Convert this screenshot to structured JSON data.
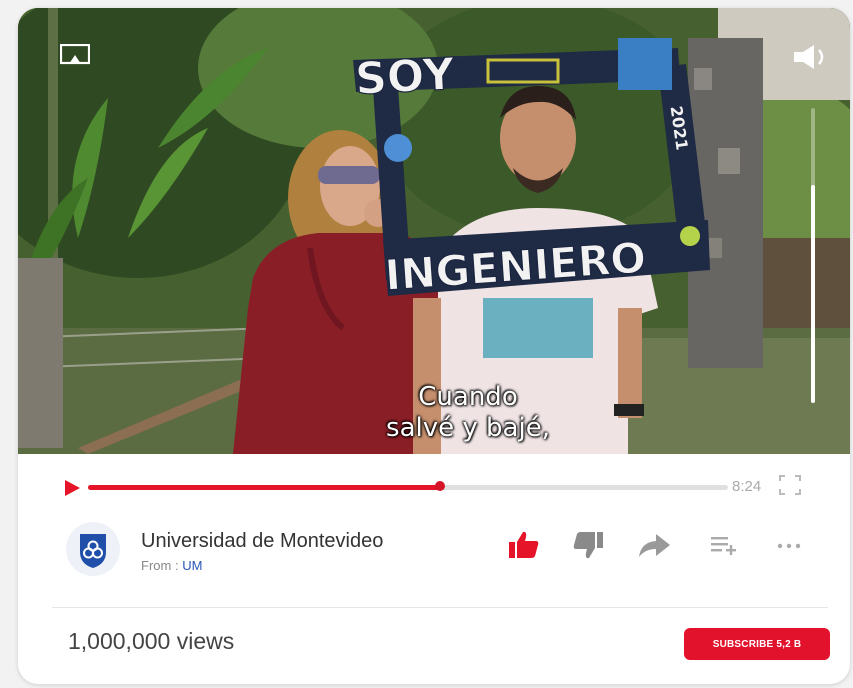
{
  "video": {
    "caption_line1": "Cuando",
    "caption_line2": "salvé y bajé,",
    "frame_sign_top": "SOY",
    "frame_sign_bottom": "INGENIERO",
    "frame_year": "2021",
    "volume_level": 0.74
  },
  "player": {
    "progress": 0.55,
    "duration": "8:24",
    "accent_color": "#e51428"
  },
  "channel": {
    "name": "Universidad de Montevideo",
    "from_label": "From :",
    "from_value": "UM"
  },
  "actions": [
    "like-icon",
    "dislike-icon",
    "share-icon",
    "add-to-playlist-icon",
    "more-icon"
  ],
  "stats": {
    "views": "1,000,000 views",
    "subscribe_label": "SUBSCRIBE 5,2 B"
  }
}
